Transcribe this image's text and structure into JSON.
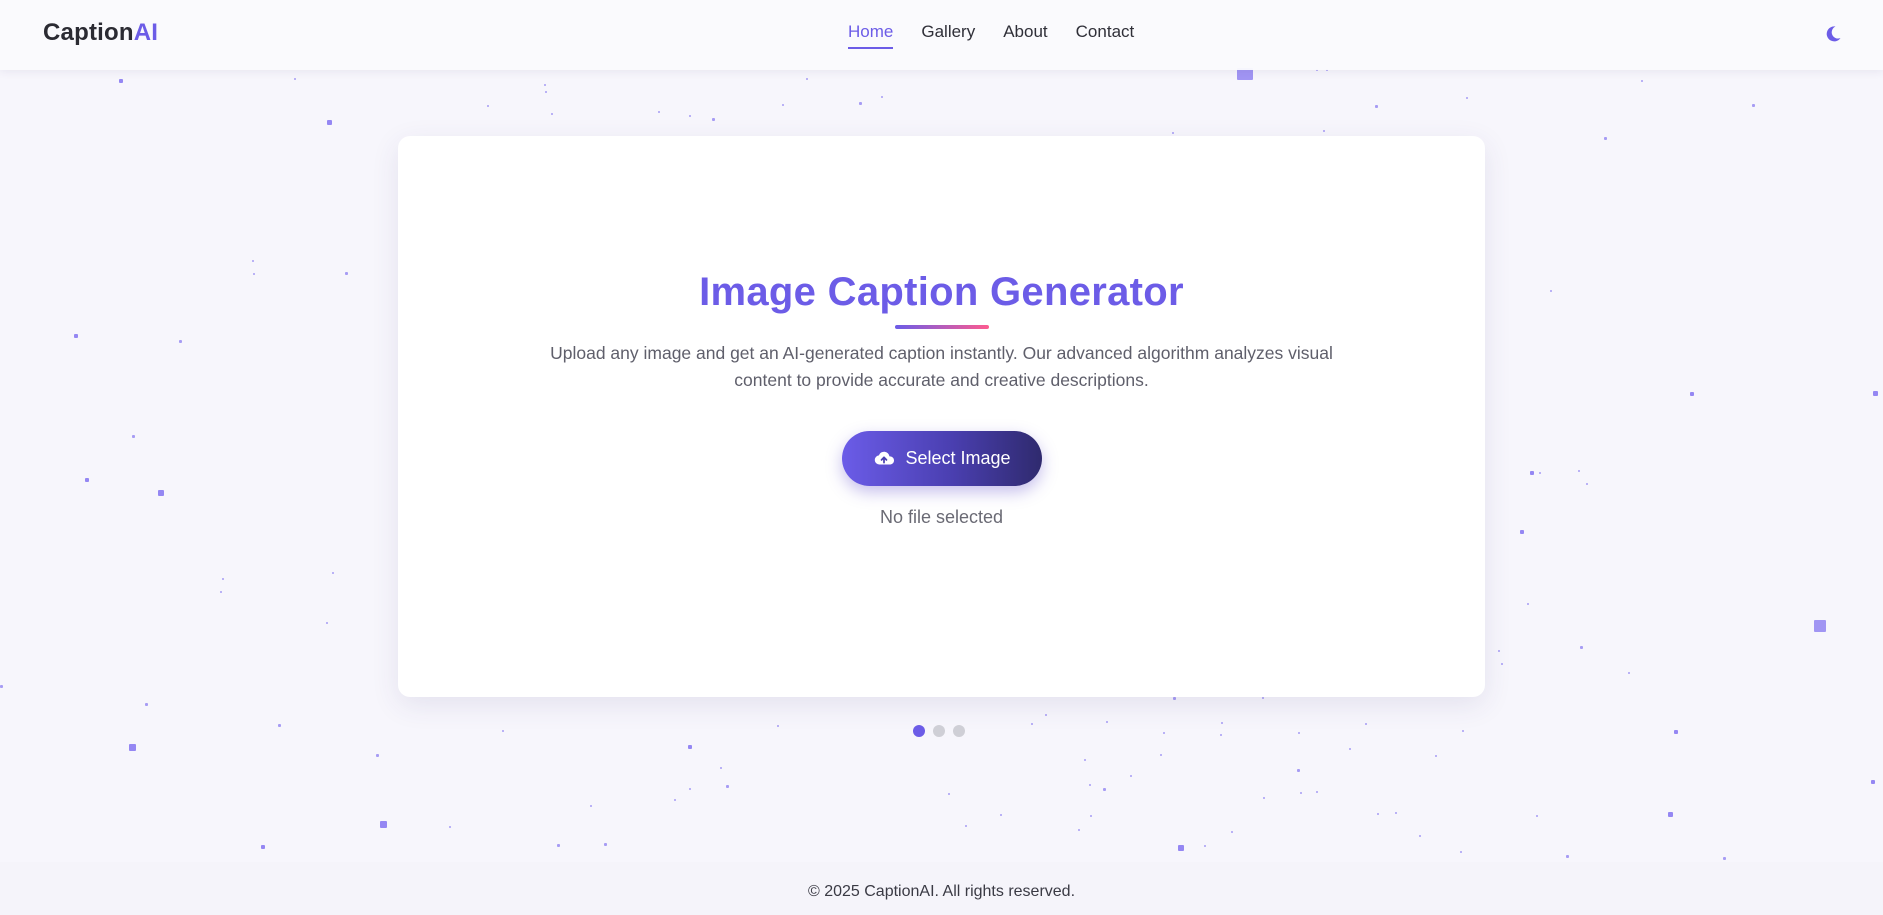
{
  "header": {
    "logo_main": "Caption",
    "logo_accent": "AI",
    "nav": [
      {
        "label": "Home",
        "active": true
      },
      {
        "label": "Gallery",
        "active": false
      },
      {
        "label": "About",
        "active": false
      },
      {
        "label": "Contact",
        "active": false
      }
    ],
    "theme_toggle_icon": "moon-icon"
  },
  "main": {
    "title": "Image Caption Generator",
    "description": "Upload any image and get an AI-generated caption instantly. Our advanced algorithm analyzes visual content to provide accurate and creative descriptions.",
    "select_button": {
      "label": "Select Image",
      "icon": "cloud-upload-icon"
    },
    "file_status": "No file selected"
  },
  "pagination": {
    "count": 3,
    "active_index": 0
  },
  "footer": {
    "text": "© 2025 CaptionAI. All rights reserved."
  },
  "colors": {
    "accent": "#6c5ce7",
    "accent_pink": "#fd5b8f",
    "background": "#f7f6fc",
    "particle": "#7c6cf0"
  }
}
